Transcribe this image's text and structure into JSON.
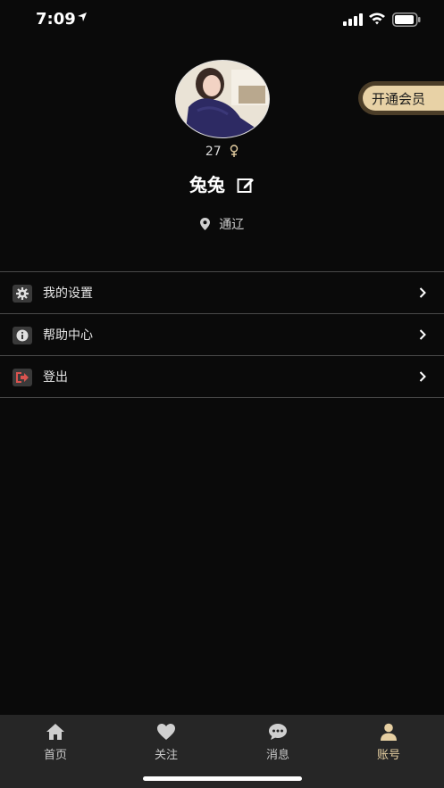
{
  "status_bar": {
    "time": "7:09"
  },
  "profile": {
    "age": "27",
    "name": "兔兔",
    "location": "通辽"
  },
  "vip": {
    "label": "开通会员"
  },
  "menu": {
    "items": [
      {
        "label": "我的设置",
        "icon": "gear-icon"
      },
      {
        "label": "帮助中心",
        "icon": "info-icon"
      },
      {
        "label": "登出",
        "icon": "logout-icon"
      }
    ]
  },
  "tabs": [
    {
      "label": "首页",
      "icon": "home-icon"
    },
    {
      "label": "关注",
      "icon": "heart-icon"
    },
    {
      "label": "消息",
      "icon": "chat-icon"
    },
    {
      "label": "账号",
      "icon": "person-icon",
      "active": true
    }
  ],
  "colors": {
    "background": "#0a0a0a",
    "accent": "#e6cfa2",
    "tab_bar": "#262626",
    "logout_icon": "#d9534f"
  }
}
